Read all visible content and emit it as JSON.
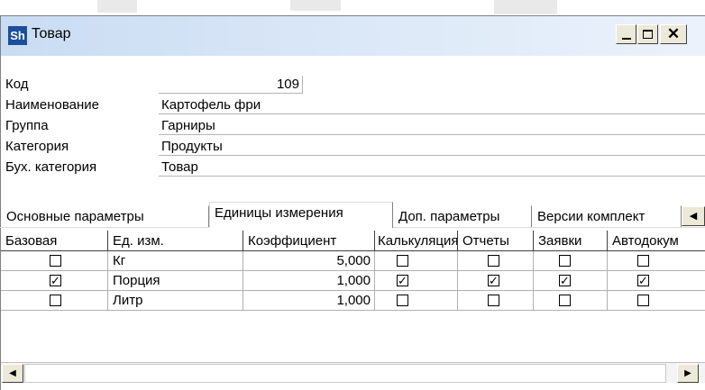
{
  "window": {
    "title": "Товар",
    "app_icon_text": "Sh",
    "buttons": [
      "minimize",
      "maximize",
      "close"
    ]
  },
  "fields": [
    {
      "label": "Код",
      "value": "109"
    },
    {
      "label": "Наименование",
      "value": "Картофель фри"
    },
    {
      "label": "Группа",
      "value": "Гарниры"
    },
    {
      "label": "Категория",
      "value": "Продукты"
    },
    {
      "label": "Бух. категория",
      "value": "Товар"
    }
  ],
  "tabs": [
    {
      "label": "Основные параметры",
      "active": false
    },
    {
      "label": "Единицы измерения",
      "active": true
    },
    {
      "label": "Доп. параметры",
      "active": false
    },
    {
      "label": "Версии комплект",
      "active": false
    }
  ],
  "table": {
    "headers": [
      "Базовая",
      "Ед. изм.",
      "Коэффициент",
      "Калькуляция",
      "Отчеты",
      "Заявки",
      "Автодокум"
    ],
    "rows": [
      {
        "base": false,
        "unit": "Кг",
        "coef": "5,000",
        "calc": false,
        "reports": false,
        "requests": false,
        "autodoc": false
      },
      {
        "base": true,
        "unit": "Порция",
        "coef": "1,000",
        "calc": true,
        "reports": true,
        "requests": true,
        "autodoc": true
      },
      {
        "base": false,
        "unit": "Литр",
        "coef": "1,000",
        "calc": false,
        "reports": false,
        "requests": false,
        "autodoc": false
      }
    ]
  },
  "colors": {
    "titlebar": "#c9dcf3",
    "border": "#808080"
  }
}
